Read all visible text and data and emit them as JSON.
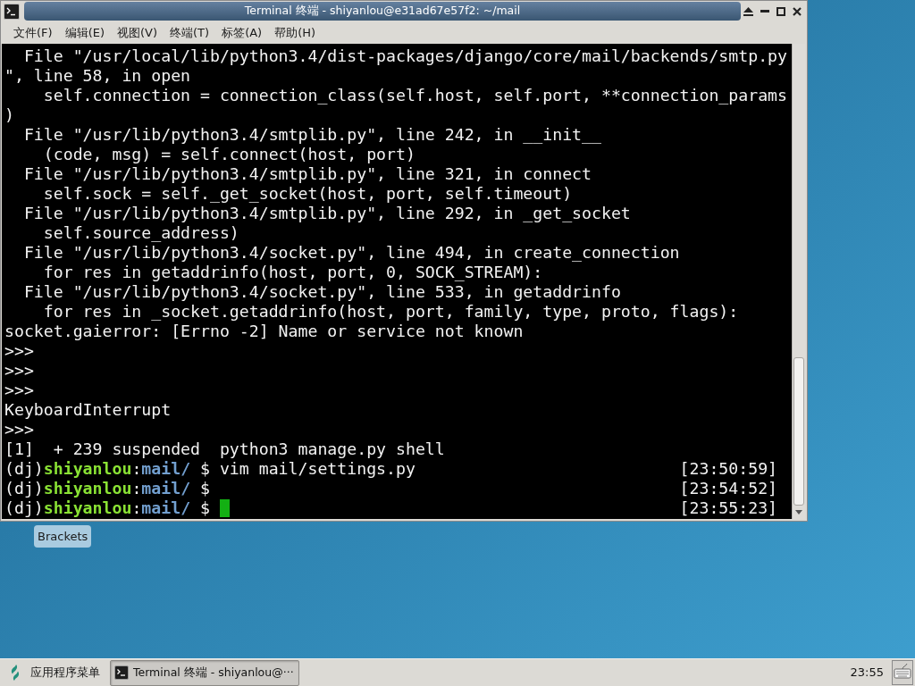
{
  "window": {
    "title": "Terminal 终端 - shiyanlou@e31ad67e57f2: ~/mail"
  },
  "menu_bar": [
    "文件(F)",
    "编辑(E)",
    "视图(V)",
    "终端(T)",
    "标签(A)",
    "帮助(H)"
  ],
  "terminal": {
    "lines": [
      {
        "kind": "output",
        "text": "  File \"/usr/local/lib/python3.4/dist-packages/django/core/mail/backends/smtp.py"
      },
      {
        "kind": "output",
        "text": "\", line 58, in open"
      },
      {
        "kind": "output",
        "text": "    self.connection = connection_class(self.host, self.port, **connection_params"
      },
      {
        "kind": "output",
        "text": ")"
      },
      {
        "kind": "output",
        "text": "  File \"/usr/lib/python3.4/smtplib.py\", line 242, in __init__"
      },
      {
        "kind": "output",
        "text": "    (code, msg) = self.connect(host, port)"
      },
      {
        "kind": "output",
        "text": "  File \"/usr/lib/python3.4/smtplib.py\", line 321, in connect"
      },
      {
        "kind": "output",
        "text": "    self.sock = self._get_socket(host, port, self.timeout)"
      },
      {
        "kind": "output",
        "text": "  File \"/usr/lib/python3.4/smtplib.py\", line 292, in _get_socket"
      },
      {
        "kind": "output",
        "text": "    self.source_address)"
      },
      {
        "kind": "output",
        "text": "  File \"/usr/lib/python3.4/socket.py\", line 494, in create_connection"
      },
      {
        "kind": "output",
        "text": "    for res in getaddrinfo(host, port, 0, SOCK_STREAM):"
      },
      {
        "kind": "output",
        "text": "  File \"/usr/lib/python3.4/socket.py\", line 533, in getaddrinfo"
      },
      {
        "kind": "output",
        "text": "    for res in _socket.getaddrinfo(host, port, family, type, proto, flags):"
      },
      {
        "kind": "output",
        "text": "socket.gaierror: [Errno -2] Name or service not known"
      },
      {
        "kind": "output",
        "text": ">>>"
      },
      {
        "kind": "output",
        "text": ">>>"
      },
      {
        "kind": "output",
        "text": ">>>"
      },
      {
        "kind": "output",
        "text": "KeyboardInterrupt"
      },
      {
        "kind": "output",
        "text": ">>>"
      },
      {
        "kind": "output",
        "text": "[1]  + 239 suspended  python3 manage.py shell"
      },
      {
        "kind": "prompt",
        "env": "(dj)",
        "user": "shiyanlou",
        "separator": ":",
        "directory": "mail/",
        "symbol": "$",
        "command": "vim mail/settings.py",
        "time": "[23:50:59]",
        "cursor": false
      },
      {
        "kind": "prompt",
        "env": "(dj)",
        "user": "shiyanlou",
        "separator": ":",
        "directory": "mail/",
        "symbol": "$",
        "time": "[23:54:52]",
        "cursor": false
      },
      {
        "kind": "prompt",
        "env": "(dj)",
        "user": "shiyanlou",
        "separator": ":",
        "directory": "mail/",
        "symbol": "$",
        "time": "[23:55:23]",
        "cursor": true
      }
    ]
  },
  "desktop_icons": [
    {
      "label": "Brackets"
    }
  ],
  "taskbar": {
    "app_menu": "应用程序菜单",
    "tasks": [
      {
        "label": "Terminal 终端 - shiyanlou@···",
        "selected": true
      }
    ],
    "clock": "23:55"
  }
}
